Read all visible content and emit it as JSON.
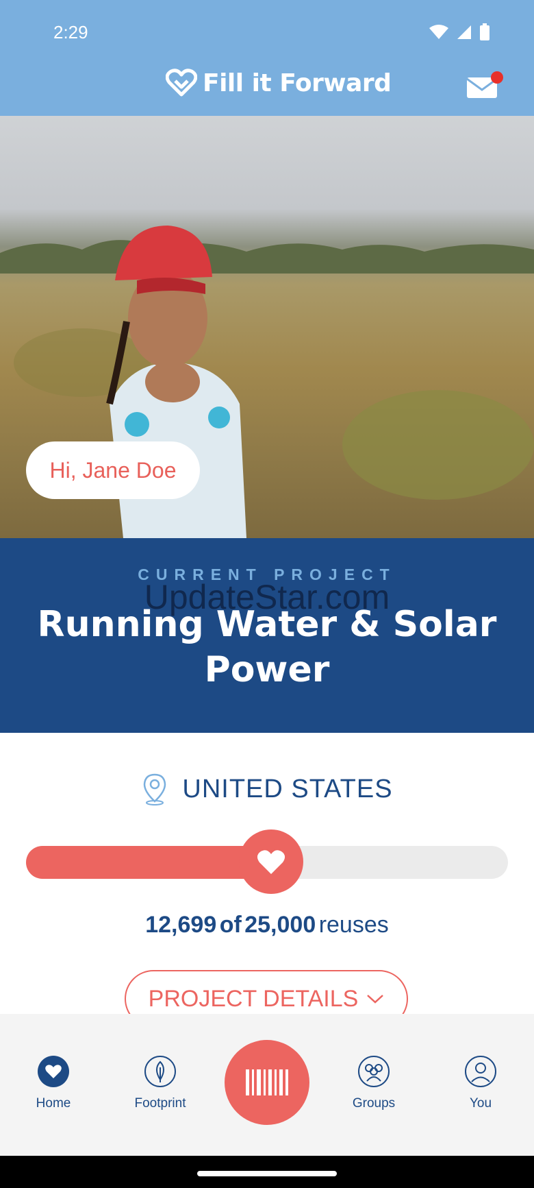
{
  "status_bar": {
    "time": "2:29"
  },
  "header": {
    "brand": "Fill it Forward",
    "brand_icon": "heart-logo-icon",
    "mail_icon": "mail-icon",
    "mail_has_notification": true
  },
  "hero": {
    "greeting": "Hi, Jane Doe"
  },
  "project": {
    "kicker": "CURRENT PROJECT",
    "watermark": "UpdateStar.com",
    "title": "Running Water & Solar Power",
    "location": "UNITED STATES",
    "progress": {
      "current": 12699,
      "goal": 25000,
      "current_label": "12,699",
      "goal_label": "25,000",
      "of": "of",
      "unit": "reuses"
    },
    "details_button": "PROJECT DETAILS"
  },
  "nav": {
    "items": [
      {
        "label": "Home",
        "icon": "heart-circle-icon",
        "active": true
      },
      {
        "label": "Footprint",
        "icon": "leaf-icon",
        "active": false
      },
      {
        "label": "Groups",
        "icon": "groups-icon",
        "active": false
      },
      {
        "label": "You",
        "icon": "user-icon",
        "active": false
      }
    ],
    "scan_icon": "barcode-icon"
  },
  "colors": {
    "header_bg": "#7aafde",
    "band_bg": "#1d4a85",
    "accent": "#ec6560"
  }
}
